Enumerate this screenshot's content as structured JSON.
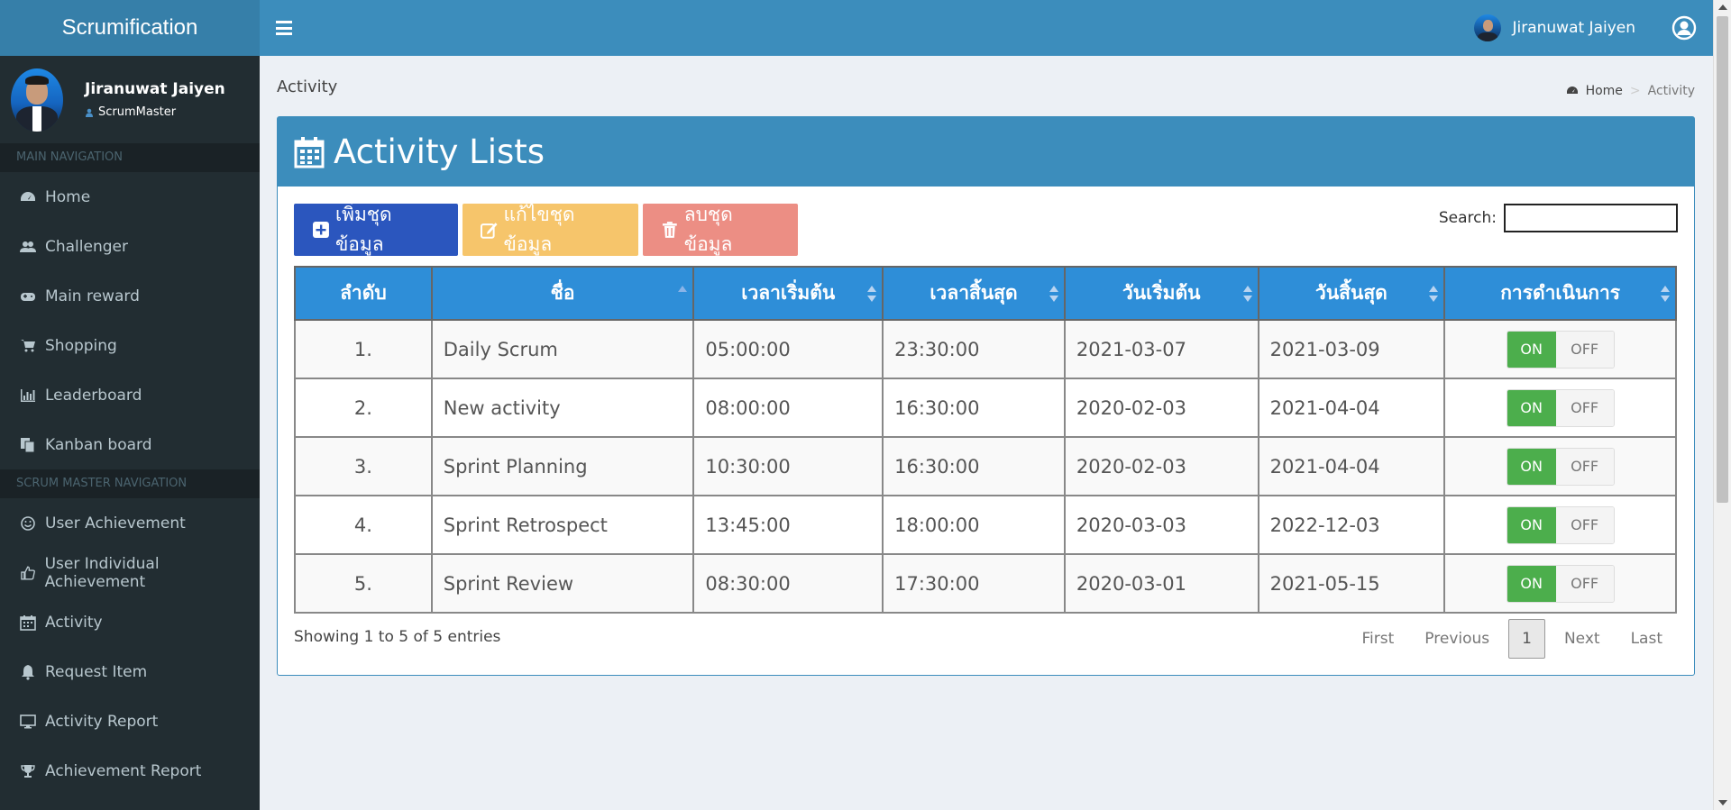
{
  "app": {
    "logo": "Scrumification"
  },
  "user": {
    "name": "Jiranuwat Jaiyen",
    "role": "ScrumMaster"
  },
  "sidebar": {
    "main_header": "MAIN NAVIGATION",
    "main_items": [
      {
        "label": "Home",
        "icon": "tachometer-icon"
      },
      {
        "label": "Challenger",
        "icon": "users-icon"
      },
      {
        "label": "Main reward",
        "icon": "gamepad-icon"
      },
      {
        "label": "Shopping",
        "icon": "shopping-cart-icon"
      },
      {
        "label": "Leaderboard",
        "icon": "bar-chart-icon"
      },
      {
        "label": "Kanban board",
        "icon": "copy-icon"
      }
    ],
    "scrum_header": "SCRUM MASTER NAVIGATION",
    "scrum_items": [
      {
        "label": "User Achievement",
        "icon": "smile-icon"
      },
      {
        "label": "User Individual Achievement",
        "icon": "thumbs-up-icon"
      },
      {
        "label": "Activity",
        "icon": "calendar-icon"
      },
      {
        "label": "Request Item",
        "icon": "bell-icon"
      },
      {
        "label": "Activity Report",
        "icon": "desktop-icon"
      },
      {
        "label": "Achievement Report",
        "icon": "trophy-icon"
      }
    ]
  },
  "page": {
    "title": "Activity",
    "breadcrumb_home": "Home",
    "breadcrumb_sep": ">",
    "breadcrumb_current": "Activity"
  },
  "box": {
    "title": "Activity Lists",
    "add_label": "เพิ่มชุดข้อมูล",
    "edit_label": "แก้ไขชุดข้อมูล",
    "delete_label": "ลบชุดข้อมูล",
    "search_label": "Search:",
    "search_value": ""
  },
  "table": {
    "headers": [
      "ลำดับ",
      "ชื่อ",
      "เวลาเริ่มต้น",
      "เวลาสิ้นสุด",
      "วันเริ่มต้น",
      "วันสิ้นสุด",
      "การดำเนินการ"
    ],
    "rows": [
      {
        "no": "1.",
        "name": "Daily Scrum",
        "start_time": "05:00:00",
        "end_time": "23:30:00",
        "start_date": "2021-03-07",
        "end_date": "2021-03-09",
        "on": "ON",
        "off": "OFF"
      },
      {
        "no": "2.",
        "name": "New activity",
        "start_time": "08:00:00",
        "end_time": "16:30:00",
        "start_date": "2020-02-03",
        "end_date": "2021-04-04",
        "on": "ON",
        "off": "OFF"
      },
      {
        "no": "3.",
        "name": "Sprint Planning",
        "start_time": "10:30:00",
        "end_time": "16:30:00",
        "start_date": "2020-02-03",
        "end_date": "2021-04-04",
        "on": "ON",
        "off": "OFF"
      },
      {
        "no": "4.",
        "name": "Sprint Retrospect",
        "start_time": "13:45:00",
        "end_time": "18:00:00",
        "start_date": "2020-03-03",
        "end_date": "2022-12-03",
        "on": "ON",
        "off": "OFF"
      },
      {
        "no": "5.",
        "name": "Sprint Review",
        "start_time": "08:30:00",
        "end_time": "17:30:00",
        "start_date": "2020-03-01",
        "end_date": "2021-05-15",
        "on": "ON",
        "off": "OFF"
      }
    ]
  },
  "footer": {
    "showing": "Showing 1 to 5 of 5 entries",
    "first": "First",
    "previous": "Previous",
    "page": "1",
    "next": "Next",
    "last": "Last"
  },
  "colors": {
    "header": "#3c8dbc",
    "sidebar": "#222d32",
    "table_header": "#2e8ed8",
    "on": "#4cae4c"
  }
}
